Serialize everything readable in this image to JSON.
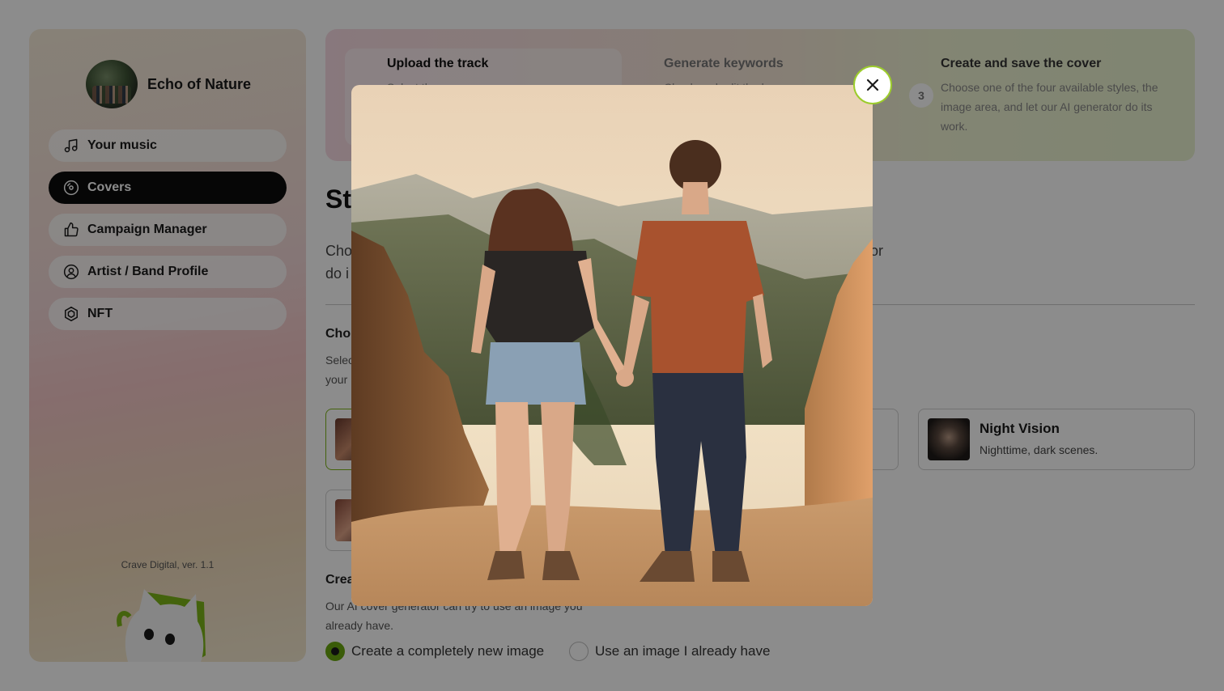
{
  "sidebar": {
    "profile_name": "Echo of Nature",
    "items": [
      {
        "label": "Your music",
        "icon": "music-note-icon"
      },
      {
        "label": "Covers",
        "icon": "disc-icon",
        "active": true
      },
      {
        "label": "Campaign Manager",
        "icon": "thumbs-up-icon"
      },
      {
        "label": "Artist / Band Profile",
        "icon": "user-circle-icon"
      },
      {
        "label": "NFT",
        "icon": "nft-hexagon-icon"
      }
    ],
    "version": "Crave Digital, ver. 1.1"
  },
  "steps": [
    {
      "title": "Upload the track",
      "description": "Select the"
    },
    {
      "title": "Generate keywords",
      "description": "Check and edit the keyw"
    },
    {
      "number": "3",
      "title": "Create and save the cover",
      "description": "Choose one of the four available styles, the image area, and let our AI generator do its work."
    }
  ],
  "main": {
    "title": "St",
    "description_line1": "Cho",
    "description_tail": "or",
    "description_line2": "do i",
    "styles_title": "Cho",
    "styles_desc_line1": "Selec",
    "styles_desc_line2": "your",
    "style_cards": [
      {
        "name": "Night Vision",
        "description": "Nighttime, dark scenes."
      }
    ],
    "image_title": "Crea",
    "image_desc_line1": "Our AI cover generator can try to use an image you",
    "image_desc_line2": "already have.",
    "radio_options": [
      {
        "label": "Create a completely new image",
        "checked": true
      },
      {
        "label": "Use an image I already have",
        "checked": false
      }
    ]
  },
  "modal": {
    "image_subject": "couple-holding-hands-canyon",
    "close_icon": "close-icon"
  },
  "colors": {
    "accent_green": "#7cb518",
    "active_nav": "#0c0c0c",
    "overlay": "rgba(0,0,0,0.45)"
  }
}
